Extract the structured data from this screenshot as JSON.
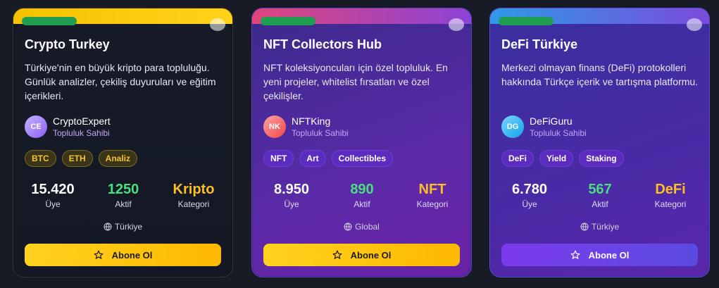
{
  "cards": [
    {
      "title": "Crypto Turkey",
      "description": "Türkiye'nin en büyük kripto para topluluğu. Günlük analizler, çekiliş duyuruları ve eğitim içerikleri.",
      "owner": {
        "initials": "CE",
        "name": "CryptoExpert",
        "role": "Topluluk Sahibi",
        "avatar_color": "#a78bfa"
      },
      "tags": [
        "BTC",
        "ETH",
        "Analiz"
      ],
      "stats": [
        {
          "value": "15.420",
          "label": "Üye"
        },
        {
          "value": "1250",
          "label": "Aktif"
        },
        {
          "value": "Kripto",
          "label": "Kategori"
        }
      ],
      "location": "Türkiye",
      "cta_label": "Abone Ol"
    },
    {
      "title": "NFT Collectors Hub",
      "description": "NFT koleksiyoncuları için özel topluluk. En yeni projeler, whitelist fırsatları ve özel çekilişler.",
      "owner": {
        "initials": "NK",
        "name": "NFTKing",
        "role": "Topluluk Sahibi",
        "avatar_color": "#f87171"
      },
      "tags": [
        "NFT",
        "Art",
        "Collectibles"
      ],
      "stats": [
        {
          "value": "8.950",
          "label": "Üye"
        },
        {
          "value": "890",
          "label": "Aktif"
        },
        {
          "value": "NFT",
          "label": "Kategori"
        }
      ],
      "location": "Global",
      "cta_label": "Abone Ol"
    },
    {
      "title": "DeFi Türkiye",
      "description": "Merkezi olmayan finans (DeFi) protokolleri hakkında Türkçe içerik ve tartışma platformu.",
      "owner": {
        "initials": "DG",
        "name": "DeFiGuru",
        "role": "Topluluk Sahibi",
        "avatar_color": "#38bdf8"
      },
      "tags": [
        "DeFi",
        "Yield",
        "Staking"
      ],
      "stats": [
        {
          "value": "6.780",
          "label": "Üye"
        },
        {
          "value": "567",
          "label": "Aktif"
        },
        {
          "value": "DeFi",
          "label": "Kategori"
        }
      ],
      "location": "Türkiye",
      "cta_label": "Abone Ol"
    }
  ]
}
